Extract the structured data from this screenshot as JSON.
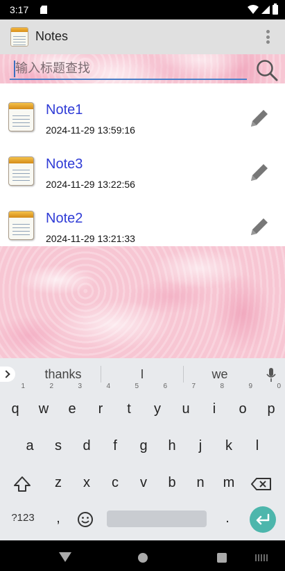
{
  "status_bar": {
    "time": "3:17"
  },
  "app_bar": {
    "title": "Notes"
  },
  "search": {
    "placeholder": "输入标题查找"
  },
  "notes": [
    {
      "title": "Note1",
      "timestamp": "2024-11-29 13:59:16"
    },
    {
      "title": "Note3",
      "timestamp": "2024-11-29 13:22:56"
    },
    {
      "title": "Note2",
      "timestamp": "2024-11-29 13:21:33"
    }
  ],
  "keyboard": {
    "suggestions": [
      "thanks",
      "I",
      "we"
    ],
    "row1": [
      "q",
      "w",
      "e",
      "r",
      "t",
      "y",
      "u",
      "i",
      "o",
      "p"
    ],
    "row1_hints": [
      "1",
      "2",
      "3",
      "4",
      "5",
      "6",
      "7",
      "8",
      "9",
      "0"
    ],
    "row2": [
      "a",
      "s",
      "d",
      "f",
      "g",
      "h",
      "j",
      "k",
      "l"
    ],
    "row3": [
      "z",
      "x",
      "c",
      "v",
      "b",
      "n",
      "m"
    ],
    "symbols_label": "?123",
    "comma": ",",
    "period": "."
  },
  "colors": {
    "accent": "#2f3bd6",
    "enter_key": "#4db6ac",
    "search_underline": "#4a7fc9"
  },
  "icons": [
    "sd-card-icon",
    "wifi-icon",
    "signal-icon",
    "battery-icon",
    "app-notes-icon",
    "overflow-menu-icon",
    "search-icon",
    "note-icon",
    "edit-pencil-icon",
    "mic-icon",
    "shift-icon",
    "backspace-icon",
    "emoji-icon",
    "enter-icon",
    "back-icon",
    "home-icon",
    "recents-icon",
    "keyboard-switch-icon"
  ]
}
